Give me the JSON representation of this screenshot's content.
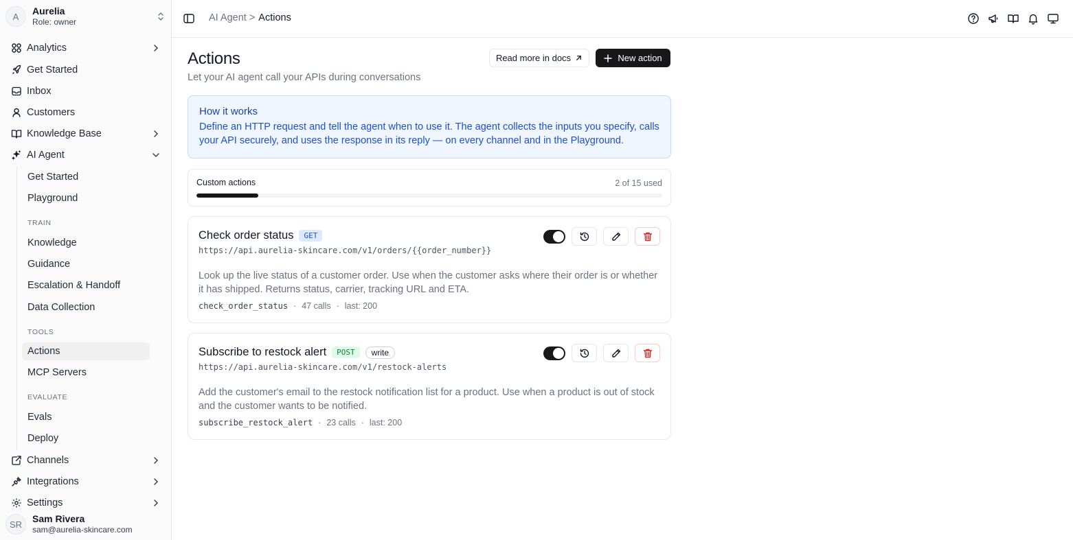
{
  "workspace": {
    "initial": "A",
    "name": "Aurelia",
    "role": "Role: owner"
  },
  "nav": {
    "analytics": "Analytics",
    "get_started": "Get Started",
    "inbox": "Inbox",
    "customers": "Customers",
    "knowledge_base": "Knowledge Base",
    "ai_agent": "AI Agent",
    "ai_agent_children": {
      "get_started": "Get Started",
      "playground": "Playground",
      "train_label": "TRAIN",
      "knowledge": "Knowledge",
      "guidance": "Guidance",
      "escalation": "Escalation & Handoff",
      "data_collection": "Data Collection",
      "tools_label": "TOOLS",
      "actions": "Actions",
      "mcp_servers": "MCP Servers",
      "evaluate_label": "EVALUATE",
      "evals": "Evals",
      "deploy": "Deploy"
    },
    "channels": "Channels",
    "integrations": "Integrations",
    "settings": "Settings"
  },
  "user": {
    "initials": "SR",
    "name": "Sam Rivera",
    "email": "sam@aurelia-skincare.com"
  },
  "breadcrumb": {
    "parent": "AI Agent",
    "separator": ">",
    "current": "Actions"
  },
  "header_icons": [
    "help-icon",
    "megaphone-icon",
    "book-icon",
    "bell-icon",
    "monitor-icon"
  ],
  "page": {
    "title": "Actions",
    "subtitle": "Let your AI agent call your APIs during conversations",
    "docs_button": "Read more in docs",
    "new_button": "New action"
  },
  "info": {
    "title": "How it works",
    "body": "Define an HTTP request and tell the agent when to use it. The agent collects the inputs you specify, calls your API securely, and uses the response in its reply — on every channel and in the Playground."
  },
  "usage": {
    "label": "Custom actions",
    "count_text": "2 of 15 used",
    "used": 2,
    "limit": 15
  },
  "actions": [
    {
      "name": "Check order status",
      "method": "GET",
      "tag": "",
      "url": "https://api.aurelia-skincare.com/v1/orders/{{order_number}}",
      "description": "Look up the live status of a customer order. Use when the customer asks where their order is or whether it has shipped. Returns status, carrier, tracking URL and ETA.",
      "function": "check_order_status",
      "calls": "47 calls",
      "last": "last: 200",
      "enabled": true
    },
    {
      "name": "Subscribe to restock alert",
      "method": "POST",
      "tag": "write",
      "url": "https://api.aurelia-skincare.com/v1/restock-alerts",
      "description": "Add the customer's email to the restock notification list for a product. Use when a product is out of stock and the customer wants to be notified.",
      "function": "subscribe_restock_alert",
      "calls": "23 calls",
      "last": "last: 200",
      "enabled": true
    }
  ],
  "meta_separator": "·",
  "colors": {
    "primary": "#18181b",
    "info_bg": "#eff6ff",
    "info_text": "#1d4ed8",
    "get_badge": "#dbeafe",
    "post_badge": "#dcfce7",
    "danger": "#dc2626"
  }
}
